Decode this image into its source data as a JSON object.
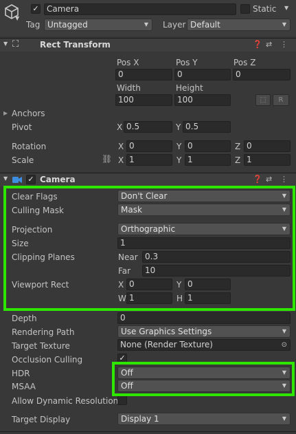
{
  "object": {
    "name": "Camera",
    "static_label": "Static",
    "tag_label": "Tag",
    "tag_value": "Untagged",
    "layer_label": "Layer",
    "layer_value": "Default"
  },
  "rect_transform": {
    "title": "Rect Transform",
    "pos_x_label": "Pos X",
    "pos_y_label": "Pos Y",
    "pos_z_label": "Pos Z",
    "pos_x": "0",
    "pos_y": "0",
    "pos_z": "0",
    "width_label": "Width",
    "height_label": "Height",
    "width": "100",
    "height": "100",
    "r_button": "R",
    "anchors_label": "Anchors",
    "pivot_label": "Pivot",
    "pivot_x": "0.5",
    "pivot_y": "0.5",
    "rotation_label": "Rotation",
    "rot_x": "0",
    "rot_y": "0",
    "rot_z": "0",
    "scale_label": "Scale",
    "scale_x": "1",
    "scale_y": "1",
    "scale_z": "1",
    "x": "X",
    "y": "Y",
    "z": "Z"
  },
  "camera": {
    "title": "Camera",
    "clear_flags_label": "Clear Flags",
    "clear_flags": "Don't Clear",
    "culling_mask_label": "Culling Mask",
    "culling_mask": "Mask",
    "projection_label": "Projection",
    "projection": "Orthographic",
    "size_label": "Size",
    "size": "1",
    "clipping_label": "Clipping Planes",
    "near_label": "Near",
    "near": "0.3",
    "far_label": "Far",
    "far": "10",
    "viewport_label": "Viewport Rect",
    "vx": "0",
    "vy": "0",
    "vw": "1",
    "vh": "1",
    "x": "X",
    "y": "Y",
    "w": "W",
    "h": "H",
    "depth_label": "Depth",
    "depth": "0",
    "rendering_path_label": "Rendering Path",
    "rendering_path": "Use Graphics Settings",
    "target_texture_label": "Target Texture",
    "target_texture": "None (Render Texture)",
    "occlusion_label": "Occlusion Culling",
    "hdr_label": "HDR",
    "hdr": "Off",
    "msaa_label": "MSAA",
    "msaa": "Off",
    "dynamic_res_label": "Allow Dynamic Resolution",
    "target_display_label": "Target Display",
    "target_display": "Display 1"
  },
  "colors": {
    "highlight": "#2ee600",
    "panel": "#383838"
  }
}
